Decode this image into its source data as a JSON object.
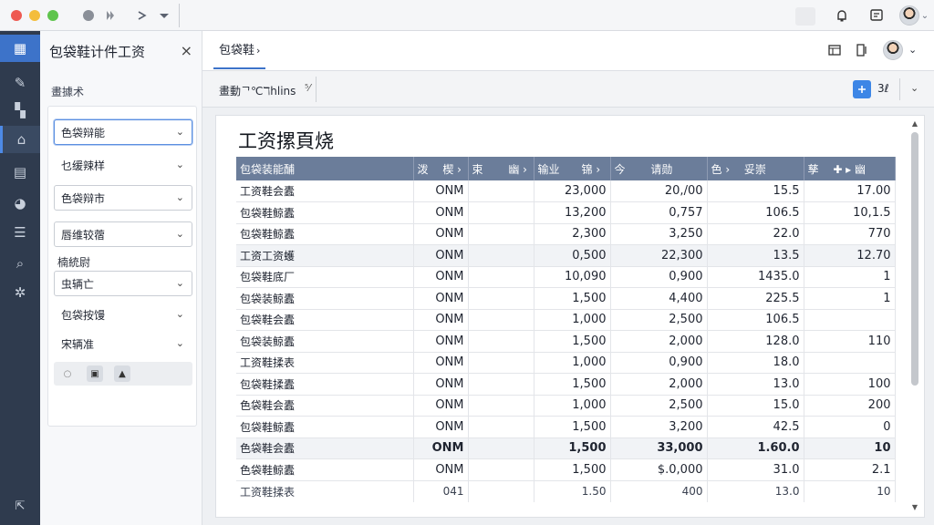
{
  "window": {
    "icons": [
      "circle-icon",
      "play-icon",
      "forward-icon",
      "dropdown-icon"
    ],
    "right_icons": [
      "notification-icon",
      "message-icon"
    ]
  },
  "nav": {
    "items": [
      {
        "name": "nav-home",
        "icon": "grid-icon",
        "glyph": "▦"
      },
      {
        "name": "nav-edit",
        "icon": "brush-icon",
        "glyph": "✎"
      },
      {
        "name": "nav-apps",
        "icon": "apps-icon",
        "glyph": "▚"
      },
      {
        "name": "nav-reports",
        "icon": "building-icon",
        "glyph": "⌂"
      },
      {
        "name": "nav-docs",
        "icon": "document-icon",
        "glyph": "▤"
      },
      {
        "name": "nav-dashboard",
        "icon": "gauge-icon",
        "glyph": "◕"
      },
      {
        "name": "nav-list",
        "icon": "list-icon",
        "glyph": "☰"
      },
      {
        "name": "nav-search",
        "icon": "search-icon",
        "glyph": "⌕"
      },
      {
        "name": "nav-settings",
        "icon": "gear-icon",
        "glyph": "✲"
      }
    ],
    "bottom_glyph": "⇱"
  },
  "panel": {
    "title": "包袋鞋计件工资",
    "close": "×",
    "subtitle": "畫據术",
    "filters": [
      {
        "value": "色袋辩能",
        "style": "focused"
      },
      {
        "value": "乜缓辣样",
        "style": "plain"
      },
      {
        "value": "色袋辩市",
        "style": "box"
      },
      {
        "value": "唇维较蓿",
        "style": "box"
      }
    ],
    "label": "楠統尉",
    "filters2": [
      {
        "value": "虫辆亡",
        "style": "box"
      },
      {
        "value": "包袋按馒",
        "style": "plain"
      },
      {
        "value": "宋辆准",
        "style": "plain"
      }
    ],
    "mini_buttons": [
      "○",
      "▣",
      "▲"
    ]
  },
  "main": {
    "tab_label": "包袋鞋",
    "tab_chevron": "›",
    "header_icons": [
      "layout-icon",
      "split-icon"
    ],
    "toolbar_label": "畫動ᄀ℃ℸhlins",
    "toolbar_x": "⁵⁄",
    "toolbar_num": "3ℓ",
    "report_title": "工资摞頁烧",
    "columns": [
      "包袋装能酺",
      "泼　 楔 ›",
      "束　　 幽 ›",
      "输业　　锦 ›",
      "今　　 请勋",
      "色 ›　 妥崇",
      "孳　 ✚ ▸ 幽"
    ],
    "rows": [
      {
        "name": "工资鞋会蠹",
        "code": "ONM",
        "v1": "23,000",
        "v2": "20,/00",
        "v3": "15.5",
        "v4": "17.00"
      },
      {
        "name": "包袋鞋鲸蠹",
        "code": "ONM",
        "v1": "13,200",
        "v2": "0,757",
        "v3": "106.5",
        "v4": "10,1.5"
      },
      {
        "name": "包袋鞋鲸蠹",
        "code": "ONM",
        "v1": "2,300",
        "v2": "3,250",
        "v3": "22.0",
        "v4": "770"
      },
      {
        "name": "工资工资蠖",
        "code": "ONM",
        "v1": "0,500",
        "v2": "22,300",
        "v3": "13.5",
        "v4": "12.70",
        "shade": true
      },
      {
        "name": "包袋鞋底厂",
        "code": "ONM",
        "v1": "10,090",
        "v2": "0,900",
        "v3": "1435.0",
        "v4": "1"
      },
      {
        "name": "包袋装鲸蠹",
        "code": "ONM",
        "v1": "1,500",
        "v2": "4,400",
        "v3": "225.5",
        "v4": "1"
      },
      {
        "name": "包袋鞋会蠹",
        "code": "ONM",
        "v1": "1,000",
        "v2": "2,500",
        "v3": "106.5",
        "v4": ""
      },
      {
        "name": "包袋装鲸蠹",
        "code": "ONM",
        "v1": "1,500",
        "v2": "2,000",
        "v3": "128.0",
        "v4": "110"
      },
      {
        "name": "工资鞋揉表",
        "code": "ONM",
        "v1": "1,000",
        "v2": "0,900",
        "v3": "18.0",
        "v4": ""
      },
      {
        "name": "包袋鞋揉蠹",
        "code": "ONM",
        "v1": "1,500",
        "v2": "2,000",
        "v3": "13.0",
        "v4": "100"
      },
      {
        "name": "色袋鞋会蠹",
        "code": "ONM",
        "v1": "1,000",
        "v2": "2,500",
        "v3": "15.0",
        "v4": "200"
      },
      {
        "name": "包袋鞋鲸蠹",
        "code": "ONM",
        "v1": "1,500",
        "v2": "3,200",
        "v3": "42.5",
        "v4": "0"
      },
      {
        "name": "色袋鞋会蠹",
        "code": "ONM",
        "v1": "1,500",
        "v2": "33,000",
        "v3": "1.60.0",
        "v4": "10",
        "shade": true,
        "bold": true
      },
      {
        "name": "色袋鞋鲸蠹",
        "code": "ONM",
        "v1": "1,500",
        "v2": "$.0,000",
        "v3": "31.0",
        "v4": "2.1"
      }
    ],
    "footer": {
      "name": "工资鞋揉表",
      "code": "041",
      "v1": "1.50",
      "v2": "400",
      "v3": "13.0",
      "v4": "10"
    }
  }
}
